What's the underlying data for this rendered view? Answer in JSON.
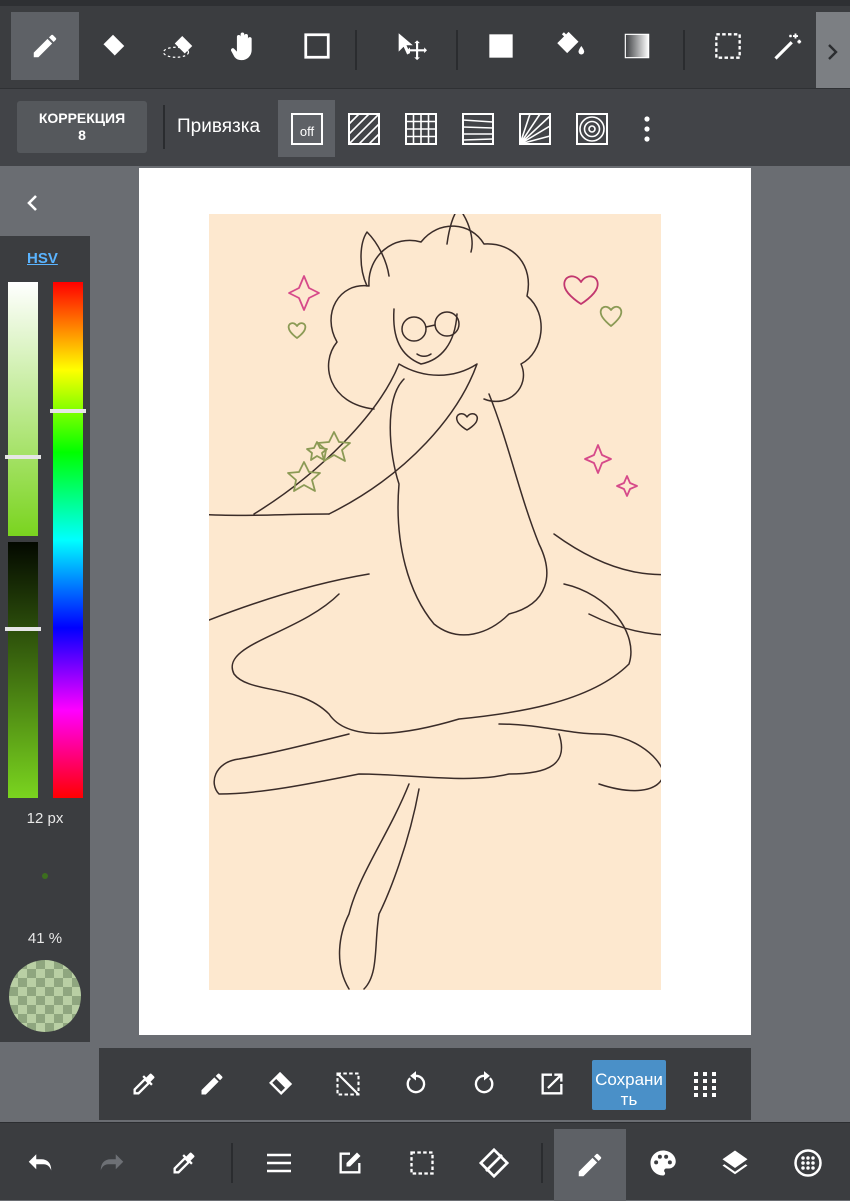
{
  "top_toolbar": {
    "tools": [
      {
        "name": "pen-tool",
        "icon": "pencil-icon",
        "active": true
      },
      {
        "name": "eraser-tool",
        "icon": "eraser-icon"
      },
      {
        "name": "blur-eraser-tool",
        "icon": "soft-eraser-icon"
      },
      {
        "name": "hand-tool",
        "icon": "hand-icon"
      },
      {
        "name": "shape-tool",
        "icon": "square-outline-icon"
      },
      {
        "name": "move-tool",
        "icon": "move-icon"
      },
      {
        "name": "fill-rect-tool",
        "icon": "filled-square-icon"
      },
      {
        "name": "bucket-tool",
        "icon": "paint-bucket-icon"
      },
      {
        "name": "gradient-tool",
        "icon": "gradient-icon"
      },
      {
        "name": "select-tool",
        "icon": "marquee-icon"
      },
      {
        "name": "magic-wand-tool",
        "icon": "magic-wand-icon"
      }
    ]
  },
  "sub_toolbar": {
    "correction_label": "КОРРЕКЦИЯ",
    "correction_value": "8",
    "snap_label": "Привязка",
    "snap_off_label": "off",
    "snap_icons": [
      "parallel-snap-icon",
      "grid-snap-icon",
      "perspective-snap-icon",
      "radial-snap-icon",
      "circle-snap-icon",
      "more-icon"
    ]
  },
  "color_panel": {
    "mode_label": "HSV",
    "brush_size": "12 px",
    "opacity": "41 %",
    "current_color": "#9eb98a",
    "saturation_level": 0.69,
    "value_level": 0.34,
    "hue_level": 0.25
  },
  "bottom_actions": {
    "save_label": "Сохранить",
    "icons": [
      "eyedropper-icon",
      "pencil-icon",
      "eraser-icon",
      "deselect-icon",
      "rotate-left-icon",
      "rotate-right-icon",
      "export-icon",
      "grid-dots-icon"
    ]
  },
  "bottom_nav": {
    "icons": [
      "undo-icon",
      "redo-icon",
      "eyedropper-icon",
      "menu-icon",
      "edit-icon",
      "selection-icon",
      "transform-icon",
      "brush-icon",
      "palette-icon",
      "layers-icon",
      "settings-icon"
    ]
  },
  "colors": {
    "toolbar_bg": "#3b3d40",
    "workspace_bg": "#6a6d72",
    "canvas_fill": "#fde8cf",
    "accent": "#4a90c8"
  }
}
